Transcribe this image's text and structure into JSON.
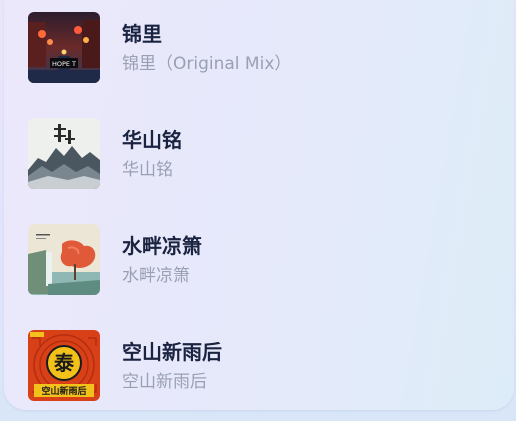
{
  "colors": {
    "title": "#1a2340",
    "subtitle": "#9aa0b4"
  },
  "tracks": [
    {
      "title": "锦里",
      "subtitle": "锦里（Original Mix）",
      "cover_icon": "night-street-cover",
      "cover_text": "HOPE T"
    },
    {
      "title": "华山铭",
      "subtitle": "华山铭",
      "cover_icon": "ink-mountain-cover"
    },
    {
      "title": "水畔凉箫",
      "subtitle": "水畔凉箫",
      "cover_icon": "waterfall-painting-cover"
    },
    {
      "title": "空山新雨后",
      "subtitle": "空山新雨后",
      "cover_icon": "red-seal-cover",
      "cover_text": "空山新雨后"
    }
  ]
}
